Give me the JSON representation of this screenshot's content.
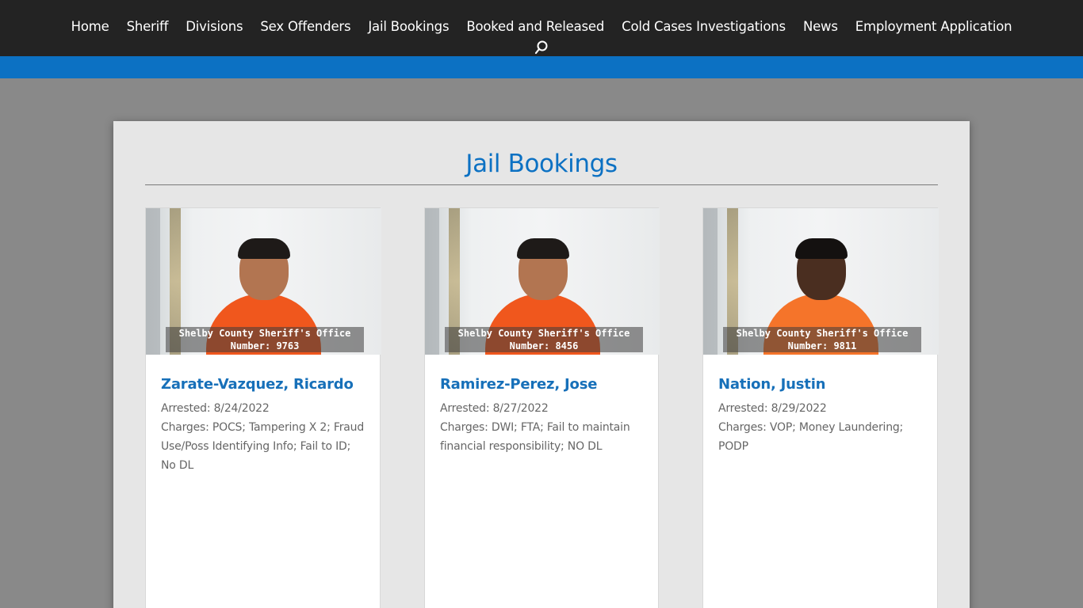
{
  "nav": {
    "items": [
      {
        "label": "Home"
      },
      {
        "label": "Sheriff"
      },
      {
        "label": "Divisions"
      },
      {
        "label": "Sex Offenders"
      },
      {
        "label": "Jail Bookings"
      },
      {
        "label": "Booked and Released"
      },
      {
        "label": "Cold Cases Investigations"
      },
      {
        "label": "News"
      },
      {
        "label": "Employment Application"
      }
    ],
    "search_icon": "search-icon"
  },
  "colors": {
    "nav_bg": "#232323",
    "accent_blue": "#0c71c3",
    "page_bg": "#898989",
    "panel_bg": "#e6e6e6"
  },
  "page": {
    "title": "Jail Bookings"
  },
  "bookings": [
    {
      "photo_line1": "Shelby County Sheriff's Office",
      "photo_line2": "Number: 9763",
      "name": "Zarate-Vazquez, Ricardo",
      "arrested": "Arrested: 8/24/2022",
      "charges": "Charges: POCS; Tampering X 2; Fraud Use/Poss Identifying Info; Fail to ID; No DL"
    },
    {
      "photo_line1": "Shelby County Sheriff's Office",
      "photo_line2": "Number: 8456",
      "name": "Ramirez-Perez, Jose",
      "arrested": "Arrested: 8/27/2022",
      "charges": "Charges: DWI; FTA; Fail to maintain financial responsibility; NO DL"
    },
    {
      "photo_line1": "Shelby County Sheriff's Office",
      "photo_line2": "Number: 9811",
      "name": "Nation, Justin",
      "arrested": "Arrested: 8/29/2022",
      "charges": "Charges: VOP; Money Laundering; PODP"
    }
  ]
}
